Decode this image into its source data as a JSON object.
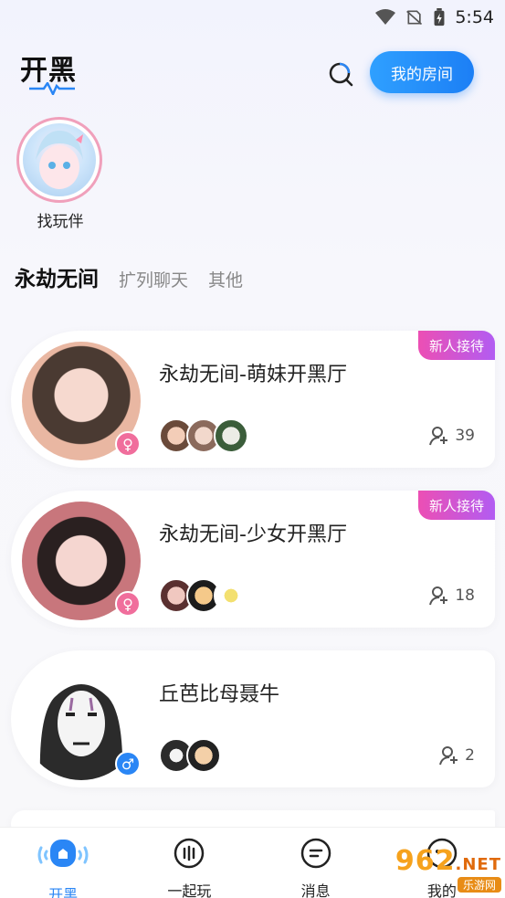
{
  "status_bar": {
    "time": "5:54",
    "icons": [
      "wifi-icon",
      "no-sim-icon",
      "battery-charging-icon"
    ]
  },
  "header": {
    "logo_text": "开黑",
    "my_room_label": "我的房间",
    "search_icon": "search-icon"
  },
  "find_partner": {
    "label": "找玩伴"
  },
  "tabs": [
    {
      "label": "永劫无间",
      "active": true
    },
    {
      "label": "扩列聊天",
      "active": false
    },
    {
      "label": "其他",
      "active": false
    }
  ],
  "rooms": [
    {
      "title": "永劫无间-萌妹开黑厅",
      "badge": "新人接待",
      "gender": "female",
      "member_count": "39",
      "members": 3
    },
    {
      "title": "永劫无间-少女开黑厅",
      "badge": "新人接待",
      "gender": "female",
      "member_count": "18",
      "members": 3
    },
    {
      "title": "丘芭比母聂牛",
      "badge": "",
      "gender": "male",
      "member_count": "2",
      "members": 2
    }
  ],
  "tabbar": [
    {
      "label": "开黑",
      "icon": "home-icon",
      "active": true
    },
    {
      "label": "一起玩",
      "icon": "play-icon",
      "active": false
    },
    {
      "label": "消息",
      "icon": "message-icon",
      "active": false
    },
    {
      "label": "我的",
      "icon": "profile-icon",
      "active": false
    }
  ],
  "watermark": {
    "text": "962",
    "suffix": ".NET",
    "sub": "乐游网"
  },
  "colors": {
    "accent": "#2a86f5",
    "female": "#f06e9c",
    "male": "#2a86f5",
    "badge_start": "#ec4fb4",
    "badge_end": "#b25cf2"
  }
}
